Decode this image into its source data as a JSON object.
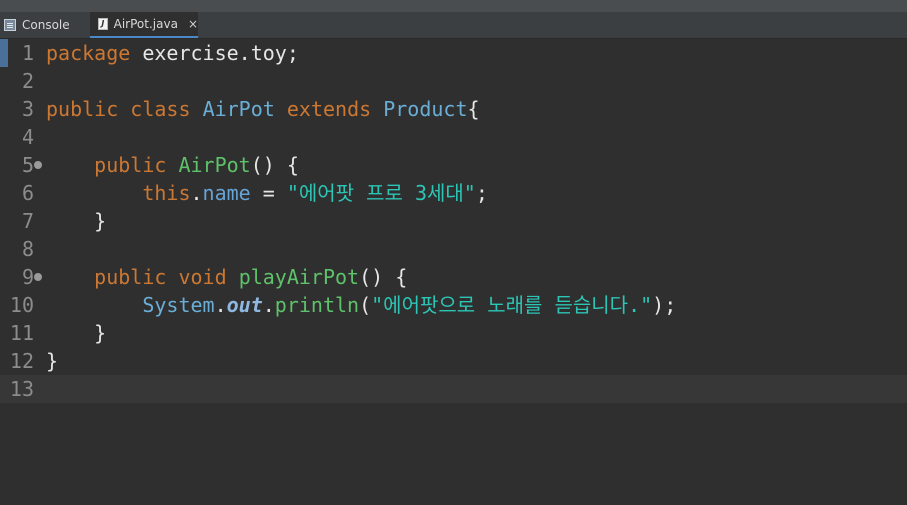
{
  "tabs": [
    {
      "label": "Console",
      "icon": "console-icon"
    },
    {
      "label": "AirPot.java",
      "icon": "java-file-icon",
      "active": true,
      "close": "×"
    }
  ],
  "lines": [
    {
      "n": "1",
      "tokens": [
        [
          "kw",
          "package"
        ],
        [
          "plain",
          " exercise.toy;"
        ]
      ]
    },
    {
      "n": "2",
      "tokens": []
    },
    {
      "n": "3",
      "tokens": [
        [
          "kw",
          "public"
        ],
        [
          "plain",
          " "
        ],
        [
          "kw",
          "class"
        ],
        [
          "plain",
          " "
        ],
        [
          "type",
          "AirPot"
        ],
        [
          "plain",
          " "
        ],
        [
          "kw",
          "extends"
        ],
        [
          "plain",
          " "
        ],
        [
          "type",
          "Product"
        ],
        [
          "plain",
          "{"
        ]
      ]
    },
    {
      "n": "4",
      "tokens": []
    },
    {
      "n": "5",
      "fold": true,
      "tokens": [
        [
          "plain",
          "    "
        ],
        [
          "kw",
          "public"
        ],
        [
          "plain",
          " "
        ],
        [
          "method",
          "AirPot"
        ],
        [
          "plain",
          "() {"
        ]
      ]
    },
    {
      "n": "6",
      "tokens": [
        [
          "plain",
          "        "
        ],
        [
          "kw",
          "this"
        ],
        [
          "plain",
          "."
        ],
        [
          "field",
          "name"
        ],
        [
          "plain",
          " = "
        ],
        [
          "str",
          "\"에어팟 프로 3세대\""
        ],
        [
          "plain",
          ";"
        ]
      ]
    },
    {
      "n": "7",
      "tokens": [
        [
          "plain",
          "    }"
        ]
      ]
    },
    {
      "n": "8",
      "tokens": []
    },
    {
      "n": "9",
      "fold": true,
      "tokens": [
        [
          "plain",
          "    "
        ],
        [
          "kw",
          "public"
        ],
        [
          "plain",
          " "
        ],
        [
          "kw",
          "void"
        ],
        [
          "plain",
          " "
        ],
        [
          "method",
          "playAirPot"
        ],
        [
          "plain",
          "() {"
        ]
      ]
    },
    {
      "n": "10",
      "tokens": [
        [
          "plain",
          "        "
        ],
        [
          "type",
          "System"
        ],
        [
          "plain",
          "."
        ],
        [
          "static",
          "out"
        ],
        [
          "plain",
          "."
        ],
        [
          "method",
          "println"
        ],
        [
          "plain",
          "("
        ],
        [
          "str",
          "\"에어팟으로 노래를 듣습니다.\""
        ],
        [
          "plain",
          ");"
        ]
      ]
    },
    {
      "n": "11",
      "tokens": [
        [
          "plain",
          "    }"
        ]
      ]
    },
    {
      "n": "12",
      "tokens": [
        [
          "plain",
          "}"
        ]
      ]
    },
    {
      "n": "13",
      "current": true,
      "tokens": []
    }
  ]
}
